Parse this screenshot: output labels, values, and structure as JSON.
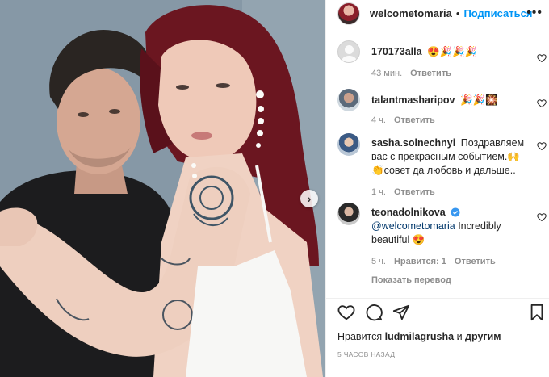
{
  "post": {
    "author": "welcometomaria",
    "separator": "•",
    "follow_label": "Подписаться",
    "more_label": "•••",
    "carousel_next": "›"
  },
  "comments": [
    {
      "user": "170173alla",
      "text": "😍🎉🎉🎉",
      "time": "43 мин.",
      "reply": "Ответить",
      "avatar_icon": "default-avatar-icon"
    },
    {
      "user": "talantmasharipov",
      "text": "🎉🎉🎇",
      "time": "4 ч.",
      "reply": "Ответить",
      "avatar_icon": "user-avatar"
    },
    {
      "user": "sasha.solnechnyi",
      "text": "Поздравляем вас с прекрасным событием.🙌👏совет да любовь и дальше..",
      "time": "1 ч.",
      "reply": "Ответить",
      "avatar_icon": "user-avatar"
    },
    {
      "user": "teonadolnikova",
      "mention": "@welcometomaria",
      "text": "Incredibly beautiful 😍",
      "time": "5 ч.",
      "likes": "Нравится: 1",
      "reply": "Ответить",
      "view_translation": "Показать перевод",
      "verified": true,
      "avatar_icon": "user-avatar"
    }
  ],
  "footer": {
    "likes_prefix": "Нравится",
    "likes_user": "ludmilagrusha",
    "likes_mid": "и",
    "likes_others": "другим",
    "time_ago": "5 ЧАСОВ НАЗАД"
  },
  "colors": {
    "accent": "#0095f6",
    "text": "#262626",
    "secondary": "#8e8e8e",
    "verified": "#3897f0"
  }
}
